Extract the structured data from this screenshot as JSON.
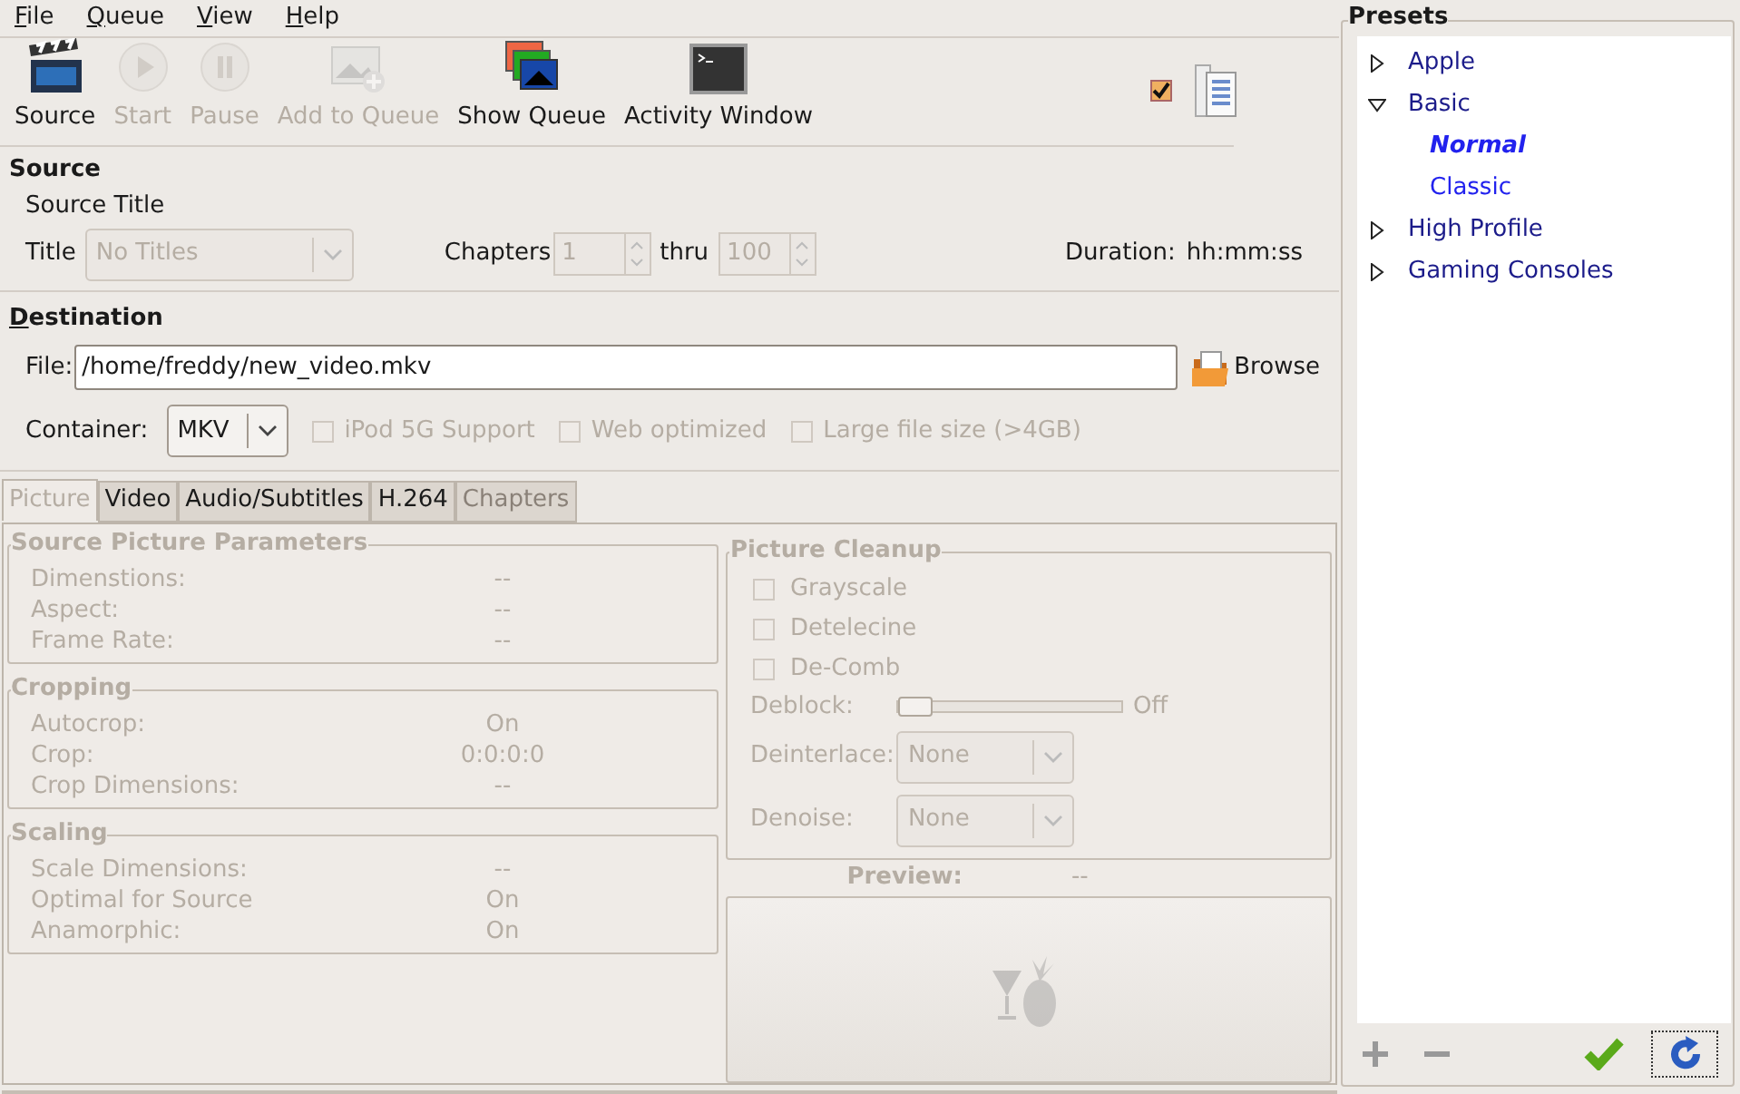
{
  "menu": [
    "File",
    "Queue",
    "View",
    "Help"
  ],
  "toolbar": [
    {
      "kind": "clapper",
      "label": "Source",
      "disabled": false
    },
    {
      "kind": "play",
      "label": "Start",
      "disabled": true
    },
    {
      "kind": "pause",
      "label": "Pause",
      "disabled": true
    },
    {
      "kind": "add",
      "label": "Add to Queue",
      "disabled": true
    },
    {
      "kind": "queue",
      "label": "Show Queue",
      "disabled": false
    },
    {
      "kind": "terminal",
      "label": "Activity Window",
      "disabled": false
    }
  ],
  "presets_toggle": {
    "checked": true
  },
  "source": {
    "heading": "Source",
    "subheading": "Source Title",
    "title_label": "Title",
    "title_value": "No Titles",
    "chapters_label": "Chapters",
    "chapter_from": "1",
    "thru_label": "thru",
    "chapter_to": "100",
    "duration_label": "Duration:",
    "duration_value": "hh:mm:ss",
    "disabled": true
  },
  "destination": {
    "heading": "Destination",
    "file_label": "File:",
    "file_value": "/home/freddy/new_video.mkv",
    "browse": "Browse",
    "container_label": "Container:",
    "container_value": "MKV",
    "options": [
      {
        "label": "iPod 5G Support",
        "checked": false,
        "disabled": true
      },
      {
        "label": "Web optimized",
        "checked": false,
        "disabled": true
      },
      {
        "label": "Large file size (>4GB)",
        "checked": false,
        "disabled": true
      }
    ]
  },
  "tabs": [
    {
      "label": "Picture",
      "selected": true,
      "disabled": false
    },
    {
      "label": "Video",
      "selected": false,
      "disabled": false
    },
    {
      "label": "Audio/Subtitles",
      "selected": false,
      "disabled": false
    },
    {
      "label": "H.264",
      "selected": false,
      "disabled": false
    },
    {
      "label": "Chapters",
      "selected": false,
      "disabled": true
    }
  ],
  "groups": [
    {
      "title": "Source Picture Parameters",
      "rows": [
        {
          "label": "Dimenstions:",
          "value": "--"
        },
        {
          "label": "Aspect:",
          "value": "--"
        },
        {
          "label": "Frame Rate:",
          "value": "--"
        }
      ]
    },
    {
      "title": "Cropping",
      "rows": [
        {
          "label": "Autocrop:",
          "value": "On"
        },
        {
          "label": "Crop:",
          "value": "0:0:0:0"
        },
        {
          "label": "Crop Dimensions:",
          "value": "--"
        }
      ]
    },
    {
      "title": "Scaling",
      "rows": [
        {
          "label": "Scale Dimensions:",
          "value": "--"
        },
        {
          "label": "Optimal for Source",
          "value": "On"
        },
        {
          "label": "Anamorphic:",
          "value": "On"
        }
      ]
    }
  ],
  "cleanup": {
    "title": "Picture Cleanup",
    "checks": [
      {
        "label": "Grayscale",
        "checked": false
      },
      {
        "label": "Detelecine",
        "checked": false
      },
      {
        "label": "De-Comb",
        "checked": false
      }
    ],
    "deblock": {
      "label": "Deblock:",
      "level": 0,
      "reading": "Off"
    },
    "selects": [
      {
        "label": "Deinterlace:",
        "value": "None"
      },
      {
        "label": "Denoise:",
        "value": "None"
      }
    ]
  },
  "preview": {
    "label": "Preview:",
    "value": "--"
  },
  "presets": {
    "title": "Presets",
    "items": [
      {
        "label": "Apple",
        "expanded": false,
        "selected": false
      },
      {
        "label": "Basic",
        "expanded": true,
        "selected": false,
        "children": [
          {
            "label": "Normal",
            "selected": true
          },
          {
            "label": "Classic",
            "selected": false
          }
        ]
      },
      {
        "label": "High Profile",
        "expanded": false,
        "selected": false
      },
      {
        "label": "Gaming Consoles",
        "expanded": false,
        "selected": false
      }
    ]
  }
}
